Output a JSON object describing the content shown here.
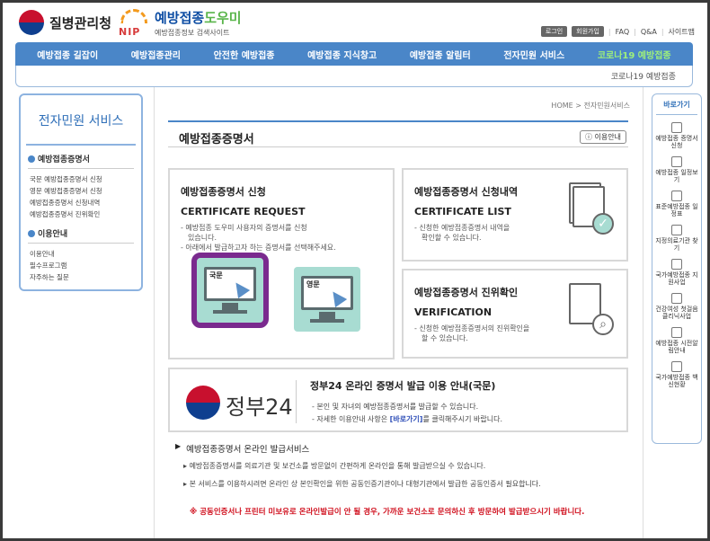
{
  "header": {
    "kdca": "질병관리청",
    "nip_title_a": "예방접종",
    "nip_title_b": "도우미",
    "nip_sub": "예방접종정보 검색사이트",
    "nip_logo": "NIP",
    "util": {
      "login": "로그인",
      "join": "회원가입",
      "faq": "FAQ",
      "qa": "Q&A",
      "sitemap": "사이트맵"
    }
  },
  "gnb": [
    "예방접종 길잡이",
    "예방접종관리",
    "안전한 예방접종",
    "예방접종 지식창고",
    "예방접종 알림터",
    "전자민원 서비스",
    "코로나19 예방접종"
  ],
  "subnav": "코로나19 예방접종",
  "lnb": {
    "title": "전자민원 서비스",
    "sec1": "예방접종증명서",
    "sec1_items": [
      "국문 예방접종증명서 신청",
      "영문 예방접종증명서 신청",
      "예방접종증명서 신청내역",
      "예방접종증명서 진위확인"
    ],
    "sec2": "이용안내",
    "sec2_items": [
      "이용안내",
      "필수프로그램",
      "자주하는 질문"
    ]
  },
  "breadcrumb": "HOME > 전자민원서비스",
  "page_title": "예방접종증명서",
  "help_button": "이용안내",
  "card_request": {
    "title": "예방접종증명서 신청",
    "subtitle": "CERTIFICATE REQUEST",
    "desc1": "- 예방접종 도우미 사용자의 증명서를 신청",
    "desc1b": "있습니다.",
    "desc2": "- 아래에서 발급하고자 하는 증명서를 선택해주세요.",
    "kr": "국문",
    "en": "영문"
  },
  "card_list": {
    "title": "예방접종증명서 신청내역",
    "subtitle": "CERTIFICATE LIST",
    "desc1": "- 신청한 예방접종증명서 내역을",
    "desc1b": "확인할 수 있습니다."
  },
  "card_verify": {
    "title": "예방접종증명서 진위확인",
    "subtitle": "VERIFICATION",
    "desc1": "- 신청한 예방접종증명서의 진위확인을",
    "desc1b": "할 수 있습니다."
  },
  "gov24": {
    "logo_text": "정부24",
    "title": "정부24 온라인 증명서 발급 이용 안내(국문)",
    "d1": "- 본인 및 자녀의 예방접종증명서를 발급할 수 있습니다.",
    "d2a": "- 자세한 이용안내 사항은",
    "d2b": "[바로가기]",
    "d2c": "를 클릭해주시기 바랍니다."
  },
  "online": {
    "title": "예방접종증명서 온라인 발급서비스",
    "p1": "예방접종증명서를 의료기관 및 보건소를 방문없이 간편하게 온라인을 통해 발급받으실 수 있습니다.",
    "p2": "본 서비스를 이용하시려면 온라인 상 본인확인을 위한 공동인증기관이나 대형기관에서 발급한 공동인증서 필요합니다.",
    "warn": "※ 공동인증서나 프린터 미보유로 온라인발급이 안 될 경우, 가까운 보건소로 문의하신 후 방문하여 발급받으시기 바랍니다."
  },
  "quick": {
    "title": "바로가기",
    "items": [
      "예방접종 증명서 신청",
      "예방접종 일정보기",
      "표준예방접종 일정표",
      "지정의료기관 찾기",
      "국가예방접종 지원사업",
      "건강여성 첫걸음 클리닉사업",
      "예방접종 시전알림안내",
      "국가예방접종 백신현황"
    ]
  }
}
